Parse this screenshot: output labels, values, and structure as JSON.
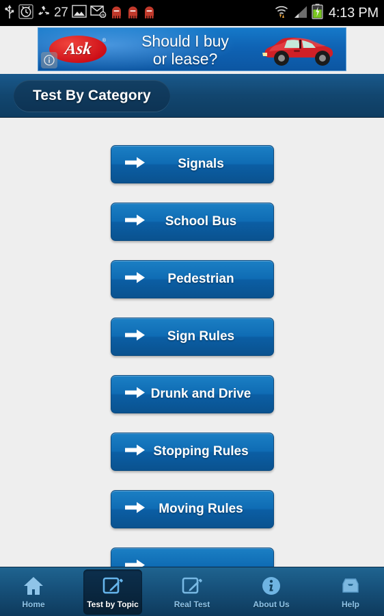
{
  "status_bar": {
    "icons": [
      "usb-icon",
      "alarm-clock-icon",
      "recycle-icon",
      "gallery-icon",
      "email-icon",
      "robot-icon",
      "robot-icon",
      "robot-icon"
    ],
    "notification_count": "27",
    "right_icons": [
      "wifi-transfer-icon",
      "cellular-signal-icon",
      "battery-charging-icon"
    ],
    "clock": "4:13 PM"
  },
  "ad": {
    "brand": "Ask",
    "brand_mark": "®",
    "headline": "Should I buy\nor lease?",
    "headline_line1": "Should I buy",
    "headline_line2": "or lease?",
    "info_label": "i",
    "image": "red-car-illustration"
  },
  "header": {
    "title": "Test By Category"
  },
  "main": {
    "categories": [
      {
        "label": "Signals",
        "icon": "arrow-right-icon",
        "cut_off": false
      },
      {
        "label": "School Bus",
        "icon": "arrow-right-icon",
        "cut_off": false
      },
      {
        "label": "Pedestrian",
        "icon": "arrow-right-icon",
        "cut_off": false
      },
      {
        "label": "Sign Rules",
        "icon": "arrow-right-icon",
        "cut_off": false
      },
      {
        "label": "Drunk and Drive",
        "icon": "arrow-right-icon",
        "cut_off": false
      },
      {
        "label": "Stopping Rules",
        "icon": "arrow-right-icon",
        "cut_off": false
      },
      {
        "label": "Moving Rules",
        "icon": "arrow-right-icon",
        "cut_off": false
      },
      {
        "label": "",
        "icon": "arrow-right-icon",
        "cut_off": true
      }
    ]
  },
  "bottom_nav": {
    "items": [
      {
        "label": "Home",
        "icon": "home-icon",
        "active": false
      },
      {
        "label": "Test by Topic",
        "icon": "edit-note-icon",
        "active": true
      },
      {
        "label": "Real Test",
        "icon": "edit-note-icon",
        "active": false
      },
      {
        "label": "About Us",
        "icon": "info-circle-icon",
        "active": false
      },
      {
        "label": "Help",
        "icon": "inbox-tray-icon",
        "active": false
      }
    ]
  },
  "colors": {
    "status_bar_bg": "#000000",
    "title_bar_blue": "#12466f",
    "button_blue": "#0f6cb4",
    "content_bg": "#eeeeee",
    "nav_bg": "#17527c",
    "nav_label": "#8fc4e8",
    "ad_red": "#cc0d16",
    "ad_blue": "#0f63b4"
  }
}
